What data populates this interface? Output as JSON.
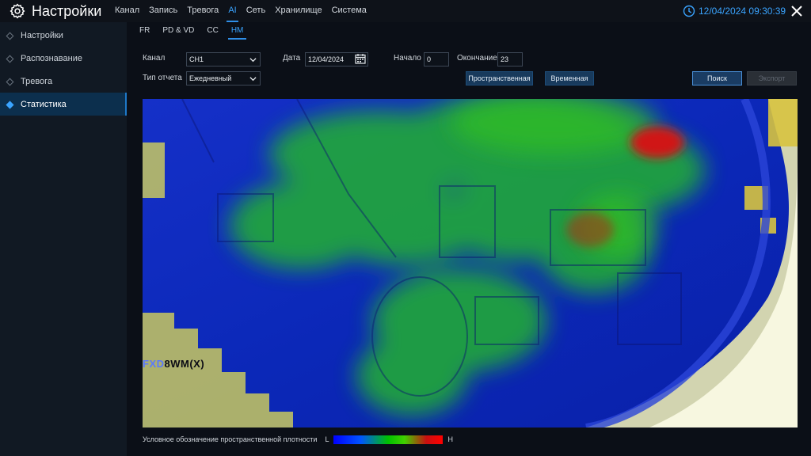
{
  "header": {
    "title": "Настройки",
    "nav": [
      {
        "label": "Канал",
        "active": false
      },
      {
        "label": "Запись",
        "active": false
      },
      {
        "label": "Тревога",
        "active": false
      },
      {
        "label": "AI",
        "active": true
      },
      {
        "label": "Сеть",
        "active": false
      },
      {
        "label": "Хранилище",
        "active": false
      },
      {
        "label": "Система",
        "active": false
      }
    ],
    "datetime": "12/04/2024 09:30:39",
    "accent_color": "#3aa4ff"
  },
  "sidebar": {
    "items": [
      {
        "label": "Настройки",
        "active": false
      },
      {
        "label": "Распознавание",
        "active": false
      },
      {
        "label": "Тревога",
        "active": false
      },
      {
        "label": "Статистика",
        "active": true
      }
    ]
  },
  "subtabs": [
    {
      "label": "FR",
      "active": false
    },
    {
      "label": "PD & VD",
      "active": false
    },
    {
      "label": "CC",
      "active": false
    },
    {
      "label": "HM",
      "active": true
    }
  ],
  "form": {
    "channel_label": "Канал",
    "channel_value": "CH1",
    "date_label": "Дата",
    "date_value": "12/04/2024",
    "start_label": "Начало",
    "start_value": "0",
    "end_label": "Окончание",
    "end_value": "23",
    "report_type_label": "Тип отчета",
    "report_type_value": "Ежедневный",
    "spatial_button": "Пространственная",
    "temporal_button": "Временная",
    "search_button": "Поиск",
    "export_button": "Экспорт"
  },
  "heatmap": {
    "camera_label_part1": "FXD",
    "camera_label_part2": "8WM(X)"
  },
  "legend": {
    "caption": "Условное обозначение пространственной плотности",
    "min_label": "L",
    "max_label": "H"
  }
}
